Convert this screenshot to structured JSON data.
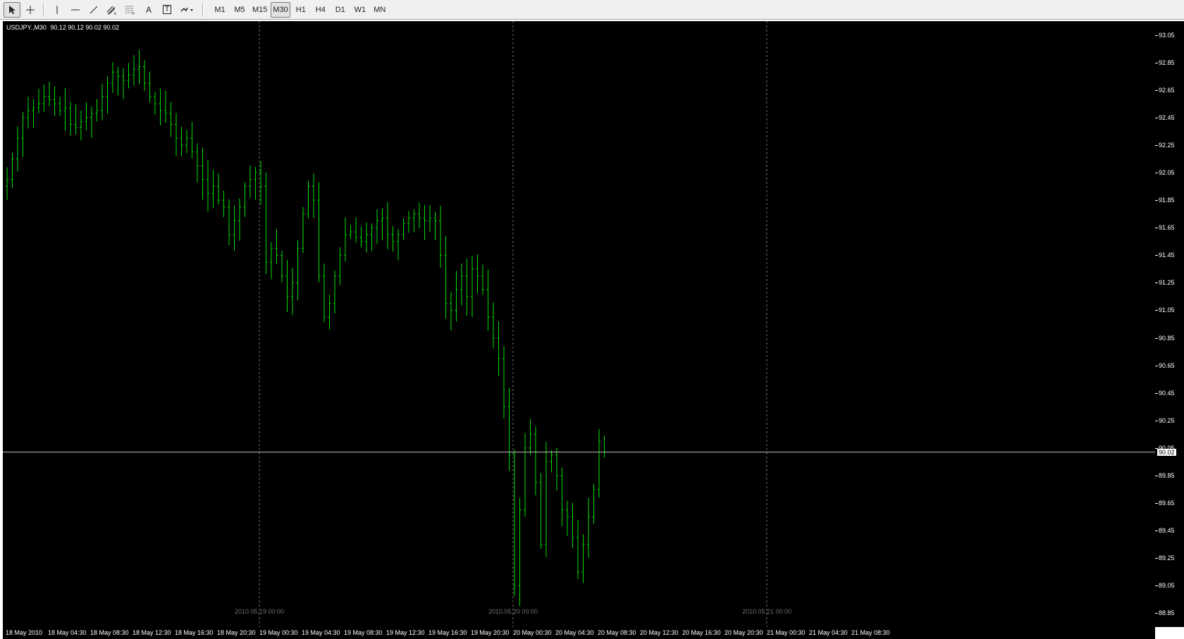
{
  "toolbar": {
    "tools": [
      {
        "name": "cursor-icon"
      },
      {
        "name": "crosshair-icon"
      },
      {
        "name": "vertical-line-icon"
      },
      {
        "name": "horizontal-line-icon"
      },
      {
        "name": "trendline-icon"
      },
      {
        "name": "equidistant-channel-icon"
      },
      {
        "name": "fibonacci-icon"
      },
      {
        "name": "text-icon",
        "label": "A"
      },
      {
        "name": "text-label-icon",
        "label": "T"
      },
      {
        "name": "arrows-icon"
      }
    ],
    "timeframes": [
      "M1",
      "M5",
      "M15",
      "M30",
      "H1",
      "H4",
      "D1",
      "W1",
      "MN"
    ],
    "active_timeframe": "M30"
  },
  "chart": {
    "symbol": "USDJPY.,M30",
    "ohlc": "90.12 90.12 90.02 90.02",
    "current_price": "90.02",
    "bar_color": "#00e000",
    "background_color": "#000000",
    "grid": false
  },
  "price_axis": [
    "93.05",
    "92.85",
    "92.65",
    "92.45",
    "92.25",
    "92.05",
    "91.85",
    "91.65",
    "91.45",
    "91.25",
    "91.05",
    "90.85",
    "90.65",
    "90.45",
    "90.25",
    "90.05",
    "89.85",
    "89.65",
    "89.45",
    "89.25",
    "89.05",
    "88.85"
  ],
  "time_axis": [
    "18 May 2010",
    "18 May 04:30",
    "18 May 08:30",
    "18 May 12:30",
    "18 May 16:30",
    "18 May 20:30",
    "19 May 00:30",
    "19 May 04:30",
    "19 May 08:30",
    "19 May 12:30",
    "19 May 16:30",
    "19 May 20:30",
    "20 May 00:30",
    "20 May 04:30",
    "20 May 08:30",
    "20 May 12:30",
    "20 May 16:30",
    "20 May 20:30",
    "21 May 00:30",
    "21 May 04:30",
    "21 May 08:30"
  ],
  "day_separators": [
    "2010.05.19 00:00",
    "2010.05.20 00:00",
    "2010.05.21 00:00"
  ],
  "chart_data": {
    "type": "ohlc",
    "series_name": "USDJPY.,M30",
    "ylim": [
      88.75,
      93.15
    ],
    "y_ticks": [
      93.05,
      92.85,
      92.65,
      92.45,
      92.25,
      92.05,
      91.85,
      91.65,
      91.45,
      91.25,
      91.05,
      90.85,
      90.65,
      90.45,
      90.25,
      90.05,
      89.85,
      89.65,
      89.45,
      89.25,
      89.05,
      88.85
    ],
    "current_price": 90.02,
    "bars_per_label": 8,
    "day_separator_bar_indices": [
      48,
      96,
      144
    ],
    "closes": [
      92.0,
      92.15,
      92.3,
      92.45,
      92.5,
      92.52,
      92.55,
      92.6,
      92.58,
      92.55,
      92.5,
      92.52,
      92.4,
      92.38,
      92.42,
      92.45,
      92.48,
      92.5,
      92.6,
      92.7,
      92.78,
      92.75,
      92.72,
      92.76,
      92.8,
      92.82,
      92.7,
      92.6,
      92.55,
      92.5,
      92.48,
      92.4,
      92.3,
      92.25,
      92.3,
      92.2,
      92.1,
      92.0,
      91.9,
      91.95,
      91.85,
      91.8,
      91.6,
      91.7,
      91.8,
      91.95,
      92.0,
      92.05,
      91.95,
      91.4,
      91.5,
      91.45,
      91.3,
      91.15,
      91.25,
      91.5,
      91.75,
      91.95,
      91.85,
      91.3,
      91.0,
      91.1,
      91.3,
      91.45,
      91.6,
      91.62,
      91.58,
      91.55,
      91.6,
      91.65,
      91.7,
      91.72,
      91.6,
      91.55,
      91.6,
      91.68,
      91.72,
      91.75,
      91.72,
      91.7,
      91.72,
      91.7,
      91.45,
      91.1,
      91.05,
      91.2,
      91.3,
      91.15,
      91.35,
      91.3,
      91.2,
      91.0,
      90.85,
      90.7,
      90.35,
      90.0,
      89.05,
      89.6,
      90.05,
      90.15,
      89.8,
      89.35,
      89.95,
      90.0,
      89.85,
      89.6,
      89.55,
      89.4,
      89.15,
      89.35,
      89.55,
      89.75,
      90.1
    ],
    "last_close": 90.02
  }
}
